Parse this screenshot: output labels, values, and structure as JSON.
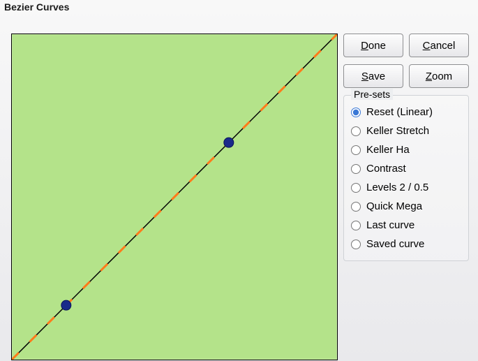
{
  "window": {
    "title": "Bezier Curves"
  },
  "buttons": {
    "done": {
      "label": "Done",
      "mnemonic_index": 0
    },
    "cancel": {
      "label": "Cancel",
      "mnemonic_index": 0
    },
    "save": {
      "label": "Save",
      "mnemonic_index": 0
    },
    "zoom": {
      "label": "Zoom",
      "mnemonic_index": 0
    }
  },
  "presets": {
    "group_label": "Pre-sets",
    "items": [
      {
        "label": "Reset (Linear)",
        "selected": true
      },
      {
        "label": "Keller Stretch",
        "selected": false
      },
      {
        "label": "Keller Ha",
        "selected": false
      },
      {
        "label": "Contrast",
        "selected": false
      },
      {
        "label": "Levels 2 / 0.5",
        "selected": false
      },
      {
        "label": "Quick Mega",
        "selected": false
      },
      {
        "label": "Last curve",
        "selected": false
      },
      {
        "label": "Saved curve",
        "selected": false
      }
    ]
  },
  "chart_data": {
    "type": "line",
    "title": "",
    "xlabel": "",
    "ylabel": "",
    "xlim": [
      0,
      1
    ],
    "ylim": [
      0,
      1
    ],
    "grid": false,
    "series": [
      {
        "name": "bezier-curve",
        "x": [
          0,
          1
        ],
        "values": [
          0,
          1
        ],
        "stroke": "#000000"
      },
      {
        "name": "identity-dashed",
        "x": [
          0,
          1
        ],
        "values": [
          0,
          1
        ],
        "stroke": "#ff7a1a",
        "dash": true
      }
    ],
    "control_points": [
      {
        "x": 0.167,
        "y": 0.167
      },
      {
        "x": 0.667,
        "y": 0.667
      }
    ],
    "colors": {
      "background": "#b4e38a",
      "curve": "#000000",
      "reference_dash": "#ff7a1a",
      "handle_fill": "#1a2a8a"
    }
  }
}
